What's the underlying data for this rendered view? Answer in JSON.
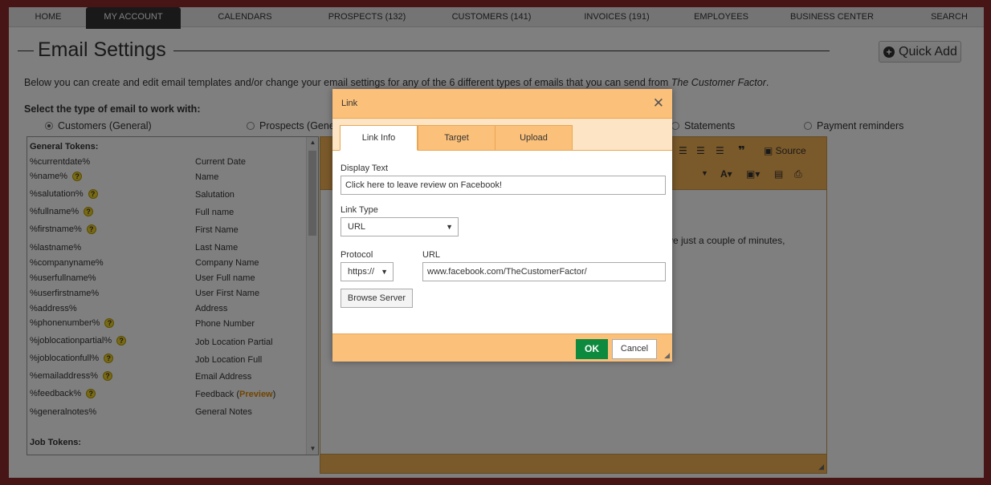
{
  "nav": {
    "items": [
      {
        "label": "HOME"
      },
      {
        "label": "MY ACCOUNT"
      },
      {
        "label": "CALENDARS"
      },
      {
        "label": "PROSPECTS (132)"
      },
      {
        "label": "CUSTOMERS (141)"
      },
      {
        "label": "INVOICES (191)"
      },
      {
        "label": "EMPLOYEES"
      },
      {
        "label": "BUSINESS CENTER"
      },
      {
        "label": "SEARCH"
      }
    ],
    "active": "MY ACCOUNT"
  },
  "header": {
    "title": "Email Settings",
    "quick_add_label": "Quick Add"
  },
  "intro": {
    "text": "Below you can create and edit email templates and/or change your email settings for any of the 6 different types of emails that you can send from ",
    "brand": "The Customer Factor",
    "suffix": "."
  },
  "email_types": {
    "label": "Select the type of email to work with:",
    "options": [
      {
        "label": "Customers (General)",
        "checked": true
      },
      {
        "label": "Prospects (Gener",
        "checked": false
      },
      {
        "label": "Statements",
        "checked": false
      },
      {
        "label": "Payment reminders",
        "checked": false
      }
    ]
  },
  "tokens": {
    "general_heading": "General Tokens:",
    "job_heading": "Job Tokens:",
    "rows": [
      {
        "token": "%currentdate%",
        "desc": "Current Date"
      },
      {
        "token": "%name%",
        "desc": "Name"
      },
      {
        "token": "%salutation%",
        "desc": "Salutation"
      },
      {
        "token": "%fullname%",
        "desc": "Full name"
      },
      {
        "token": "%firstname%",
        "desc": "First Name"
      },
      {
        "token": "%lastname%",
        "desc": "Last Name"
      },
      {
        "token": "%companyname%",
        "desc": "Company Name"
      },
      {
        "token": "%userfullname%",
        "desc": "User Full name"
      },
      {
        "token": "%userfirstname%",
        "desc": "User First Name"
      },
      {
        "token": "%address%",
        "desc": "Address"
      },
      {
        "token": "%phonenumber%",
        "desc": "Phone Number"
      },
      {
        "token": "%joblocationpartial%",
        "desc": "Job Location Partial"
      },
      {
        "token": "%joblocationfull%",
        "desc": "Job Location Full"
      },
      {
        "token": "%emailaddress%",
        "desc": "Email Address"
      },
      {
        "token": "%feedback%",
        "desc": "Feedback (",
        "link": "Preview",
        "after": ")"
      },
      {
        "token": "%generalnotes%",
        "desc": "General Notes"
      }
    ],
    "help_glyph": "?"
  },
  "editor": {
    "source_label": "Source",
    "visible_text": "ve just a couple of minutes,"
  },
  "modal": {
    "title": "Link",
    "close_glyph": "✕",
    "tabs": [
      {
        "label": "Link Info",
        "active": true
      },
      {
        "label": "Target",
        "active": false
      },
      {
        "label": "Upload",
        "active": false
      }
    ],
    "display_text_label": "Display Text",
    "display_text_value": "Click here to leave review on Facebook!",
    "link_type_label": "Link Type",
    "link_type_value": "URL",
    "protocol_label": "Protocol",
    "protocol_value": "https://",
    "url_label": "URL",
    "url_value": "www.facebook.com/TheCustomerFactor/",
    "browse_label": "Browse Server",
    "ok_label": "OK",
    "cancel_label": "Cancel"
  },
  "colors": {
    "brand_orange": "#fbc07a",
    "ok_green": "#0e8a3e",
    "frame_red": "#8f2a2a"
  }
}
